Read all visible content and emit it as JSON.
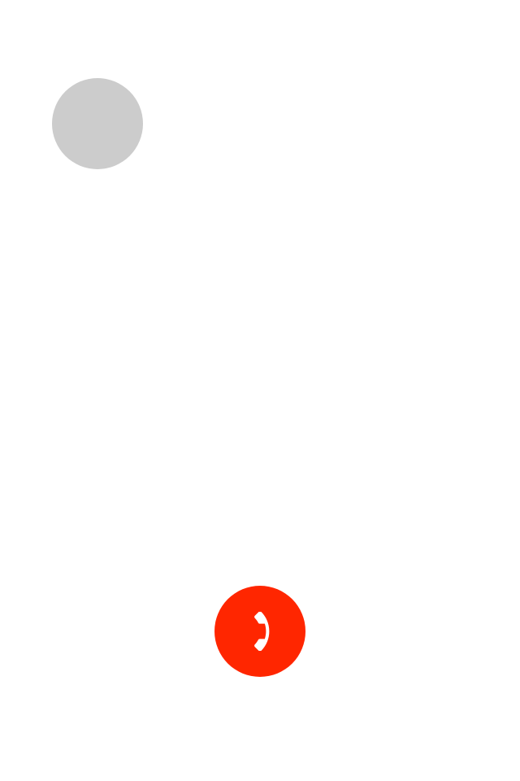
{
  "call_screen": {
    "avatar": {
      "color": "#cccccc"
    },
    "end_call_button": {
      "icon": "phone-hangup-icon",
      "color": "#ff2600",
      "icon_color": "#ffffff"
    }
  }
}
